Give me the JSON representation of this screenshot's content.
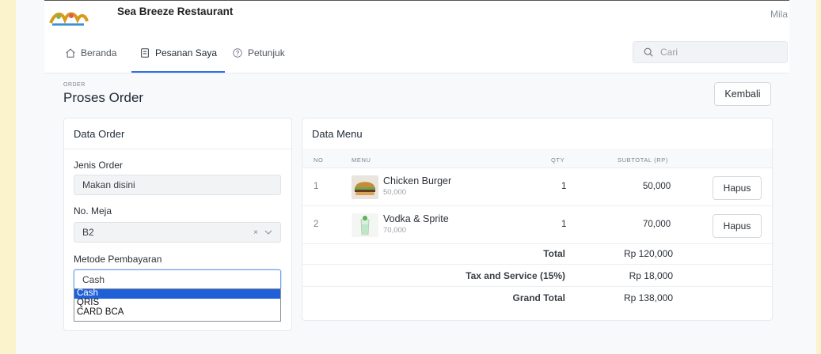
{
  "app": {
    "name": "Sea Breeze Restaurant",
    "user": "Mila"
  },
  "nav": {
    "home": "Beranda",
    "orders": "Pesanan Saya",
    "help": "Petunjuk"
  },
  "search": {
    "placeholder": "Cari"
  },
  "page": {
    "breadcrumb": "ORDER",
    "title": "Proses Order",
    "back_label": "Kembali"
  },
  "order_card": {
    "title": "Data Order",
    "order_type_label": "Jenis Order",
    "order_type_value": "Makan disini",
    "table_label": "No. Meja",
    "table_value": "B2",
    "clear_glyph": "×",
    "payment_label": "Metode Pembayaran",
    "payment_value": "Cash",
    "payment_options": [
      "Cash",
      "QRIS",
      "CARD BCA"
    ]
  },
  "menu_card": {
    "title": "Data Menu",
    "headers": {
      "no": "NO",
      "menu": "MENU",
      "qty": "QTY",
      "subtotal": "SUBTOTAL (RP)"
    },
    "rows": [
      {
        "no": "1",
        "name": "Chicken Burger",
        "price": "50,000",
        "qty": "1",
        "subtotal": "50,000",
        "action": "Hapus",
        "thumb_icon": "burger-image"
      },
      {
        "no": "2",
        "name": "Vodka & Sprite",
        "price": "70,000",
        "qty": "1",
        "subtotal": "70,000",
        "action": "Hapus",
        "thumb_icon": "drink-image"
      }
    ],
    "total_label": "Total",
    "total_value": "Rp 120,000",
    "tax_label": "Tax and Service (15%)",
    "tax_value": "Rp 18,000",
    "grand_label": "Grand Total",
    "grand_value": "Rp 138,000"
  },
  "colors": {
    "accent": "#2f6fe8",
    "selected_option": "#1f60d8"
  }
}
